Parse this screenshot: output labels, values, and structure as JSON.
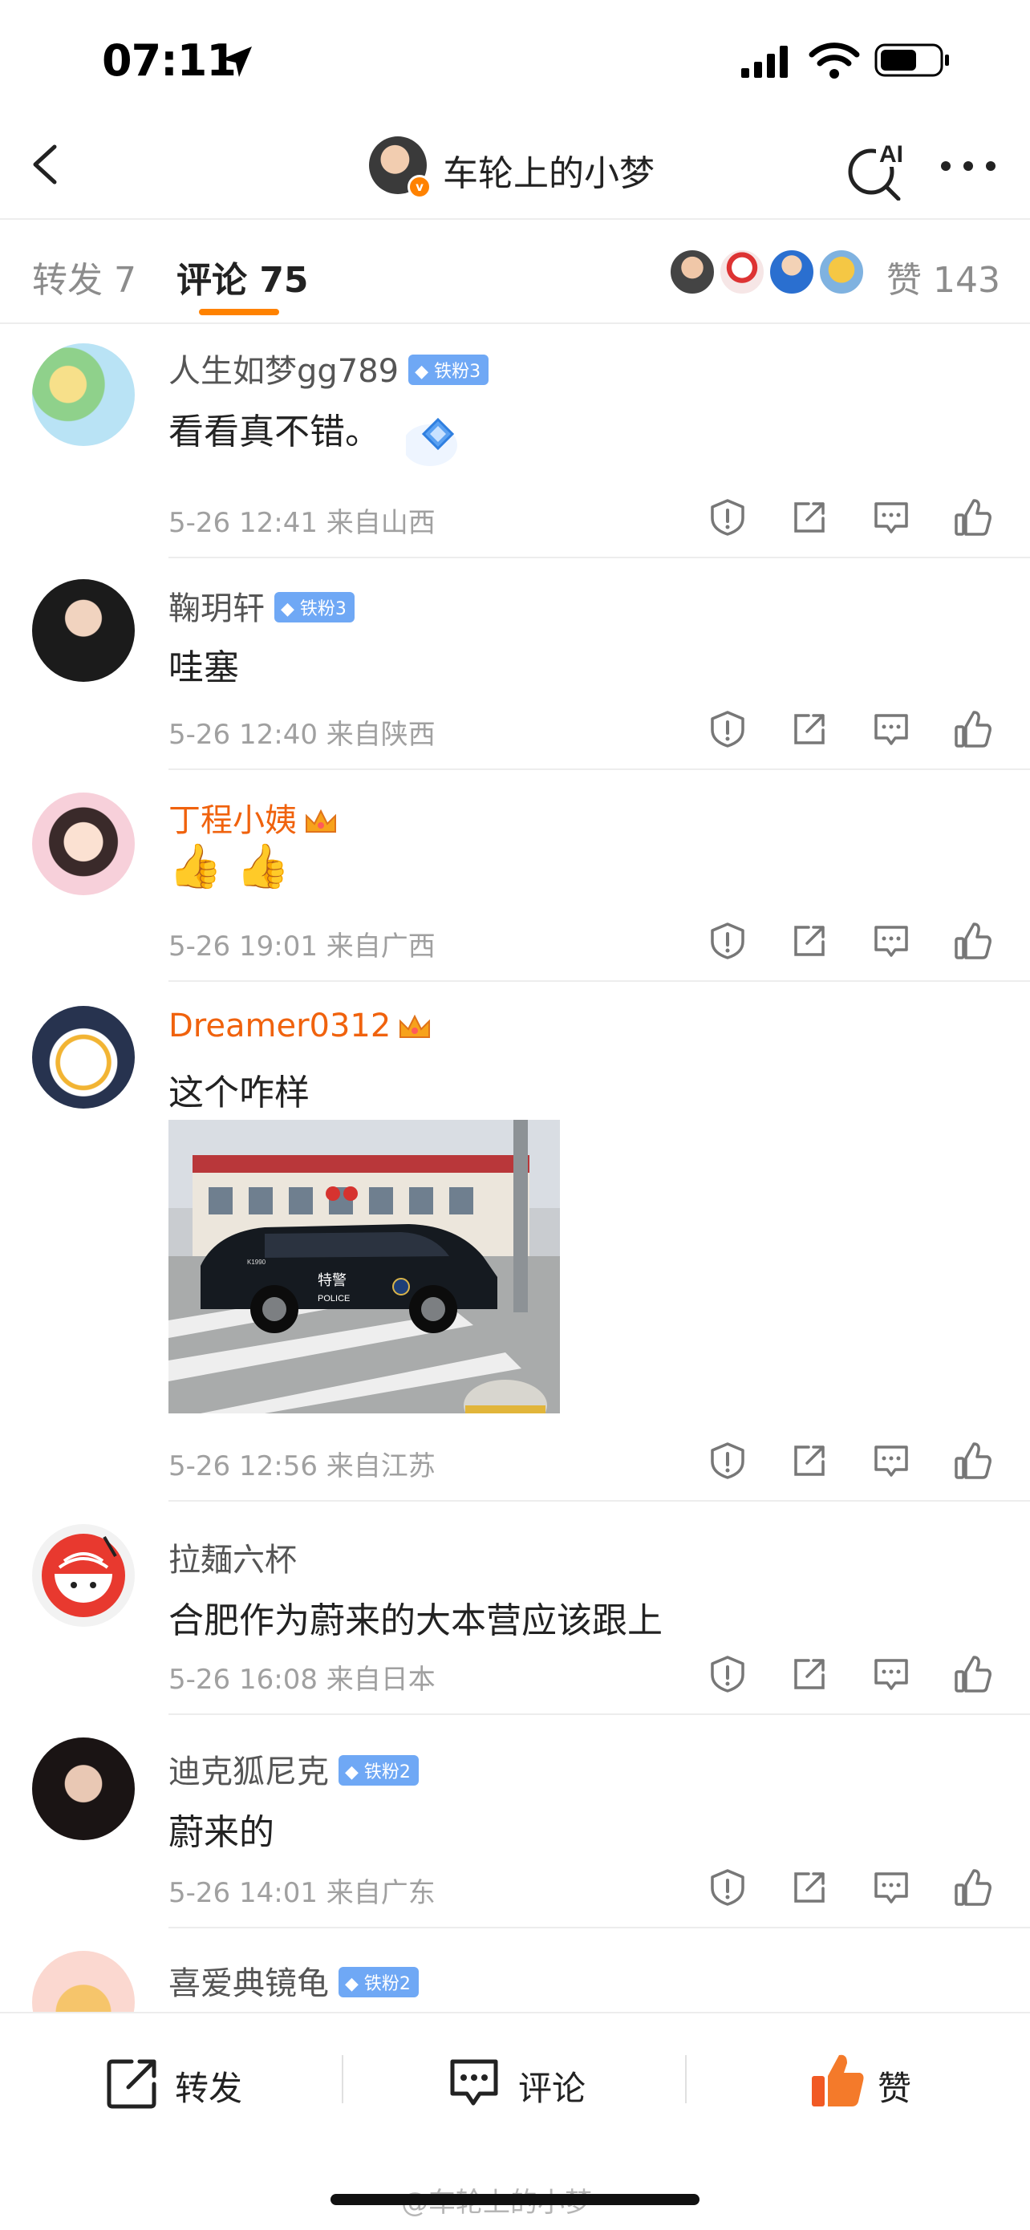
{
  "status_bar": {
    "time": "07:11"
  },
  "header": {
    "title": "车轮上的小梦",
    "ai_label": "AI"
  },
  "tabs": {
    "repost": "转发 7",
    "comments": "评论 75",
    "likes": "赞 143"
  },
  "comments": [
    {
      "user": "人生如梦gg789",
      "badge": "铁粉3",
      "text": "看看真不错。",
      "meta": "5-26 12:41 来自山西"
    },
    {
      "user": "鞠玥轩",
      "badge": "铁粉3",
      "text": "哇塞",
      "meta": "5-26 12:40 来自陕西"
    },
    {
      "user": "丁程小姨",
      "badge": "",
      "text": "👍 👍",
      "meta": "5-26 19:01 来自广西"
    },
    {
      "user": "Dreamer0312",
      "badge": "",
      "text": "这个咋样",
      "meta": "5-26 12:56 来自江苏",
      "image_text": {
        "line1": "特警",
        "line2": "POLICE",
        "plate": "K1990"
      }
    },
    {
      "user": "拉麺六杯",
      "badge": "",
      "text": "合肥作为蔚来的大本营应该跟上",
      "meta": "5-26 16:08 来自日本"
    },
    {
      "user": "迪克狐尼克",
      "badge": "铁粉2",
      "text": "蔚来的",
      "meta": "5-26 14:01 来自广东"
    },
    {
      "user": "喜爱典镜龟",
      "badge": "铁粉2",
      "text": "",
      "meta": ""
    }
  ],
  "bottom_bar": {
    "repost": "转发",
    "comment": "评论",
    "like": "赞"
  },
  "watermark": "@车轮上的小梦",
  "colors": {
    "accent": "#ff8200",
    "vip_name": "#f0620d",
    "badge_blue": "#6fa8f5",
    "like_red": "#f15a24"
  }
}
